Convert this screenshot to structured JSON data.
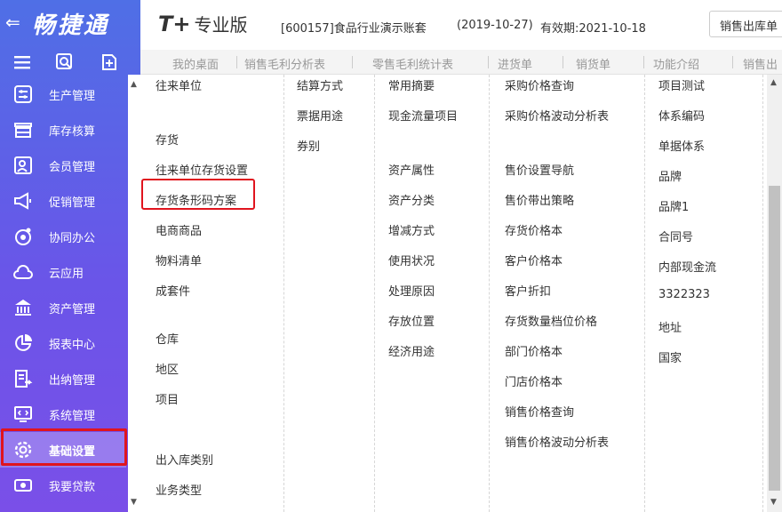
{
  "app": {
    "logo_text": "畅捷通",
    "brand_prefix": "T+",
    "brand_edition": "专业版",
    "account": "[600157]食品行业演示账套",
    "date": "(2019-10-27)",
    "valid": "有效期:2021-10-18",
    "header_button": "销售出库单"
  },
  "sidebar": {
    "items": [
      {
        "label": "生产管理",
        "icon": "production-icon"
      },
      {
        "label": "库存核算",
        "icon": "inventory-icon"
      },
      {
        "label": "会员管理",
        "icon": "member-icon"
      },
      {
        "label": "促销管理",
        "icon": "promotion-icon"
      },
      {
        "label": "协同办公",
        "icon": "collab-icon"
      },
      {
        "label": "云应用",
        "icon": "cloud-icon"
      },
      {
        "label": "资产管理",
        "icon": "asset-icon"
      },
      {
        "label": "报表中心",
        "icon": "report-icon"
      },
      {
        "label": "出纳管理",
        "icon": "cashier-icon"
      },
      {
        "label": "系统管理",
        "icon": "system-icon"
      },
      {
        "label": "基础设置",
        "icon": "settings-gear-icon",
        "active": true
      },
      {
        "label": "我要贷款",
        "icon": "loan-icon"
      }
    ]
  },
  "tabs": [
    "我的桌面",
    "销售毛利分析表",
    "零售毛利统计表",
    "进货单",
    "销货单",
    "功能介绍",
    "销售出"
  ],
  "columns": {
    "col1": [
      "往来单位",
      "存货",
      "往来单位存货设置",
      "存货条形码方案",
      "电商商品",
      "物料清单",
      "成套件",
      "仓库",
      "地区",
      "项目",
      "出入库类别",
      "业务类型"
    ],
    "col2": [
      "结算方式",
      "票据用途",
      "券别"
    ],
    "col3": [
      "常用摘要",
      "现金流量项目",
      "资产属性",
      "资产分类",
      "增减方式",
      "使用状况",
      "处理原因",
      "存放位置",
      "经济用途"
    ],
    "col4": [
      "采购价格查询",
      "采购价格波动分析表",
      "售价设置导航",
      "售价带出策略",
      "存货价格本",
      "客户价格本",
      "客户折扣",
      "存货数量档位价格",
      "部门价格本",
      "门店价格本",
      "销售价格查询",
      "销售价格波动分析表"
    ],
    "col5": [
      "项目测试",
      "体系编码",
      "单据体系",
      "品牌",
      "品牌1",
      "合同号",
      "内部现金流",
      "3322323",
      "地址",
      "国家"
    ]
  },
  "highlight_color": "#e0141e"
}
